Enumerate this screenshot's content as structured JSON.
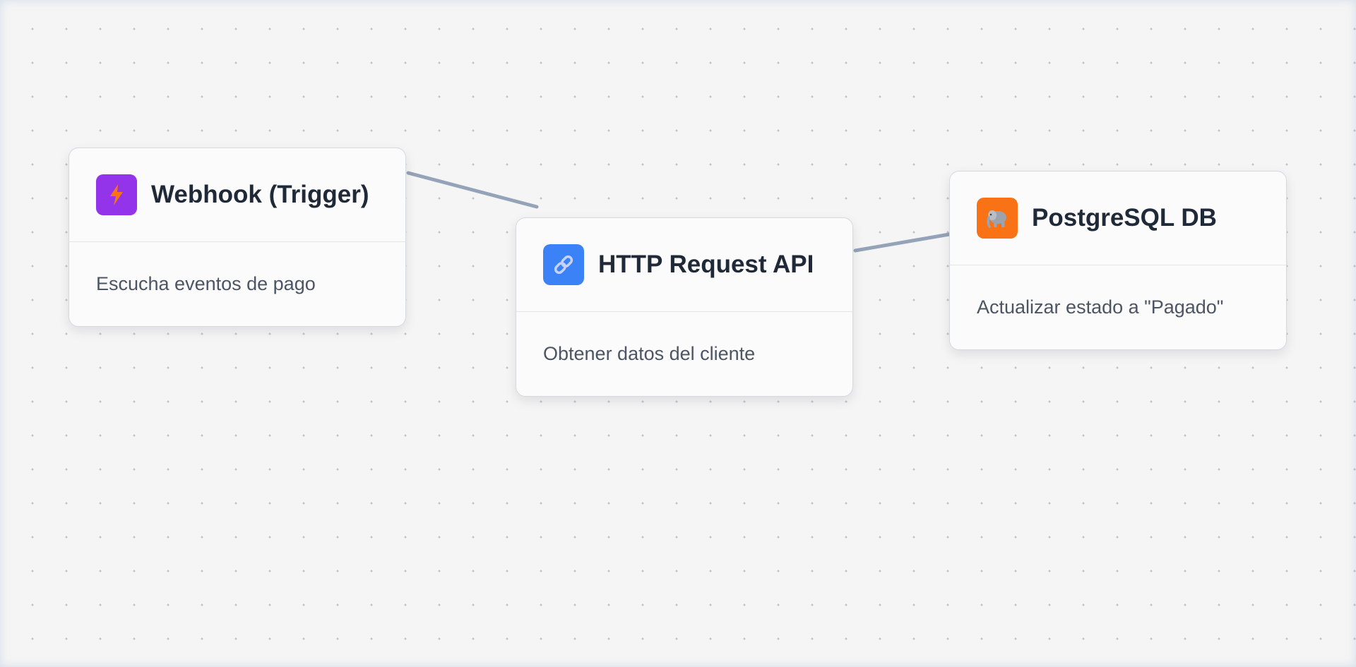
{
  "nodes": {
    "webhook": {
      "title": "Webhook (Trigger)",
      "description": "Escucha eventos de pago",
      "icon": "lightning-bolt-icon",
      "icon_color": "#9333ea",
      "icon_glyph_color": "#f97316"
    },
    "http": {
      "title": "HTTP Request API",
      "description": "Obtener datos del cliente",
      "icon": "link-icon",
      "icon_color": "#3b82f6",
      "icon_glyph_color": "#c7d2fe"
    },
    "postgres": {
      "title": "PostgreSQL DB",
      "description": "Actualizar estado a \"Pagado\"",
      "icon": "elephant-icon",
      "icon_color": "#f97316",
      "icon_glyph_color": "#9ca3af"
    }
  },
  "connection_color": "#94a3b8",
  "canvas_color": "#f5f5f5"
}
